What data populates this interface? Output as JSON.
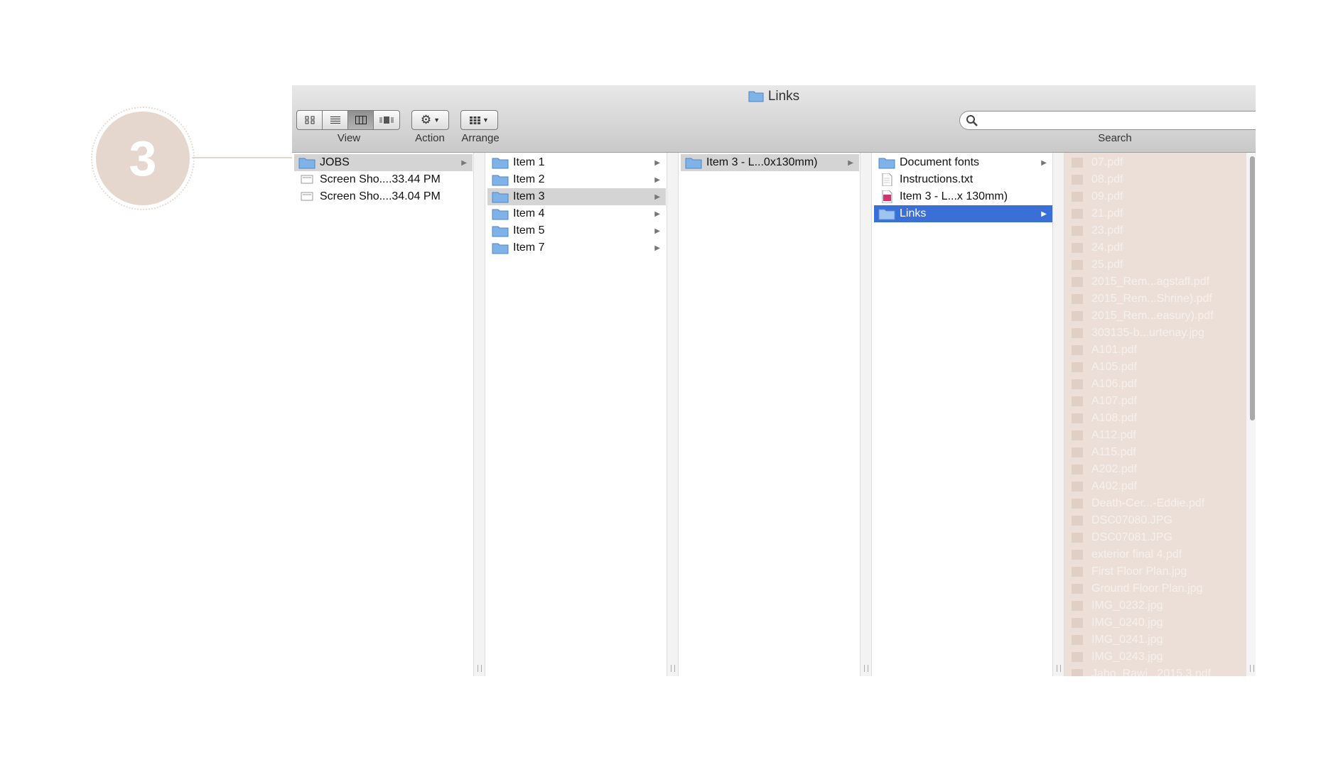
{
  "step_badge": "3",
  "window": {
    "title": "Links"
  },
  "toolbar": {
    "view_label": "View",
    "action_label": "Action",
    "arrange_label": "Arrange",
    "search_label": "Search",
    "search_value": ""
  },
  "columns": [
    {
      "items": [
        {
          "label": "JOBS",
          "icon": "folder-icon",
          "has_children": true,
          "selected": "gray"
        },
        {
          "label": "Screen Sho....33.44 PM",
          "icon": "screenshot-file-icon",
          "has_children": false
        },
        {
          "label": "Screen Sho....34.04 PM",
          "icon": "screenshot-file-icon",
          "has_children": false
        }
      ]
    },
    {
      "items": [
        {
          "label": "Item 1",
          "icon": "folder-icon",
          "has_children": true
        },
        {
          "label": "Item 2",
          "icon": "folder-icon",
          "has_children": true
        },
        {
          "label": "Item 3",
          "icon": "folder-icon",
          "has_children": true,
          "selected": "gray"
        },
        {
          "label": "Item 4",
          "icon": "folder-icon",
          "has_children": true
        },
        {
          "label": "Item 5",
          "icon": "folder-icon",
          "has_children": true
        },
        {
          "label": "Item 7",
          "icon": "folder-icon",
          "has_children": true
        }
      ]
    },
    {
      "items": [
        {
          "label": "Item 3 - L...0x130mm)",
          "icon": "folder-icon",
          "has_children": true,
          "selected": "gray"
        }
      ]
    },
    {
      "items": [
        {
          "label": "Document fonts",
          "icon": "folder-icon",
          "has_children": true
        },
        {
          "label": "Instructions.txt",
          "icon": "text-file-icon",
          "has_children": false
        },
        {
          "label": "Item 3 - L...x 130mm)",
          "icon": "indesign-file-icon",
          "has_children": false
        },
        {
          "label": "Links",
          "icon": "folder-icon",
          "has_children": true,
          "selected": "blue"
        }
      ]
    }
  ],
  "preview_files": [
    "07.pdf",
    "08.pdf",
    "09.pdf",
    "21.pdf",
    "23.pdf",
    "24.pdf",
    "25.pdf",
    "2015_Rem...agstaff.pdf",
    "2015_Rem...Shrine).pdf",
    "2015_Rem...easury).pdf",
    "303135-b...urtenay.jpg",
    "A101.pdf",
    "A105.pdf",
    "A106.pdf",
    "A107.pdf",
    "A108.pdf",
    "A112.pdf",
    "A115.pdf",
    "A202.pdf",
    "A402.pdf",
    "Death-Cer...-Eddie.pdf",
    "DSC07080.JPG",
    "DSC07081.JPG",
    "exterior final 4.pdf",
    "First Floor Plan.jpg",
    "Ground Floor Plan.jpg",
    "IMG_0232.jpg",
    "IMG_0240.jpg",
    "IMG_0241.jpg",
    "IMG_0243.jpg",
    "Jaho_Rawi...2015.3.pdf"
  ],
  "colors": {
    "badge": "#e5d7cd",
    "preview_overlay": "#ecdfd8",
    "selection_blue": "#3a6fd8",
    "selection_gray": "#d4d4d4"
  }
}
